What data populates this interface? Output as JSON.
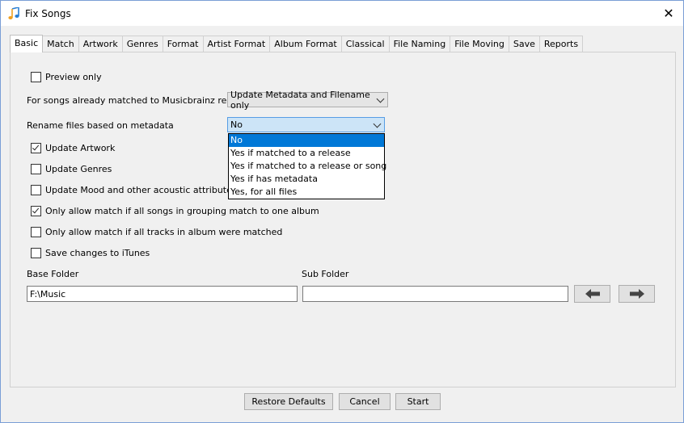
{
  "window": {
    "title": "Fix Songs",
    "app_icon": "music-note-icon",
    "close_icon": "close-icon"
  },
  "tabs": [
    {
      "label": "Basic",
      "active": true
    },
    {
      "label": "Match"
    },
    {
      "label": "Artwork"
    },
    {
      "label": "Genres"
    },
    {
      "label": "Format"
    },
    {
      "label": "Artist Format"
    },
    {
      "label": "Album Format"
    },
    {
      "label": "Classical"
    },
    {
      "label": "File Naming"
    },
    {
      "label": "File Moving"
    },
    {
      "label": "Save"
    },
    {
      "label": "Reports"
    }
  ],
  "basic": {
    "preview_only": {
      "label": "Preview only",
      "checked": false
    },
    "matched_label": "For songs already matched to Musicbrainz releases",
    "matched_value": "Update Metadata and Filename only",
    "rename_label": "Rename files based on metadata",
    "rename_value": "No",
    "rename_options": [
      "No",
      "Yes if matched to a release",
      "Yes if matched to a release or song",
      "Yes if has metadata",
      "Yes, for all files"
    ],
    "update_artwork": {
      "label": "Update Artwork",
      "checked": true
    },
    "update_genres": {
      "label": "Update Genres",
      "checked": false
    },
    "update_mood": {
      "label": "Update Mood and other acoustic attributes such",
      "checked": false
    },
    "grouping_match": {
      "label": "Only allow match if all songs in grouping match to one album",
      "checked": true
    },
    "all_tracks": {
      "label": "Only allow match if all tracks in album were matched",
      "checked": false
    },
    "save_itunes": {
      "label": "Save changes to iTunes",
      "checked": false
    },
    "base_folder_label": "Base Folder",
    "base_folder_value": "F:\\Music",
    "sub_folder_label": "Sub Folder",
    "sub_folder_value": ""
  },
  "buttons": {
    "restore": "Restore Defaults",
    "cancel": "Cancel",
    "start": "Start"
  },
  "colors": {
    "selection": "#0078d7",
    "focused_combo": "#cce4f7",
    "window_border": "#7a9ed6"
  }
}
